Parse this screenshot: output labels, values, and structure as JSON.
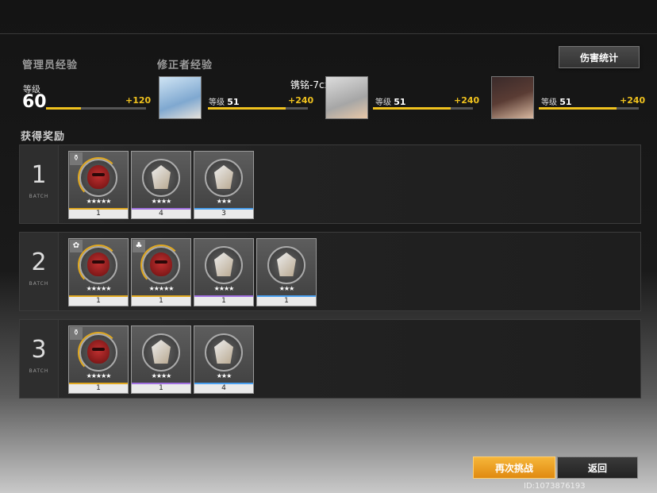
{
  "header": {
    "admin_exp_label": "管理员经验",
    "corrector_exp_label": "修正者经验",
    "damage_stats_button": "伤害统计"
  },
  "admin": {
    "level_label": "等级",
    "level": "60",
    "exp_gain": "+120",
    "exp_progress": 0.35
  },
  "characters": [
    {
      "level_label": "等级",
      "level": "51",
      "exp_gain": "+240",
      "exp_progress": 0.78,
      "portrait": "portrait-blue-hair"
    },
    {
      "level_label": "等级",
      "level": "51",
      "exp_gain": "+240",
      "exp_progress": 0.78,
      "portrait": "portrait-silver-hair",
      "name": "镌铭-7сх"
    },
    {
      "level_label": "等级",
      "level": "51",
      "exp_gain": "+240",
      "exp_progress": 0.78,
      "portrait": "portrait-dark-hair"
    }
  ],
  "rewards_label": "获得奖励",
  "batch_word": "BATCH",
  "batches": [
    {
      "number": "1",
      "items": [
        {
          "kind": "mask",
          "stars": "★★★★★",
          "count": "1",
          "rarity_color": "#e0a820",
          "tag": "⚱"
        },
        {
          "kind": "wing",
          "stars": "★★★★",
          "count": "4",
          "rarity_color": "#a070e0"
        },
        {
          "kind": "wing",
          "stars": "★★★",
          "count": "3",
          "rarity_color": "#4aa0f0"
        }
      ]
    },
    {
      "number": "2",
      "items": [
        {
          "kind": "mask",
          "stars": "★★★★★",
          "count": "1",
          "rarity_color": "#e0a820",
          "tag": "✿"
        },
        {
          "kind": "mask",
          "stars": "★★★★★",
          "count": "1",
          "rarity_color": "#e0a820",
          "tag": "♣"
        },
        {
          "kind": "wing",
          "stars": "★★★★",
          "count": "1",
          "rarity_color": "#a070e0"
        },
        {
          "kind": "wing",
          "stars": "★★★",
          "count": "1",
          "rarity_color": "#4aa0f0"
        }
      ]
    },
    {
      "number": "3",
      "items": [
        {
          "kind": "mask",
          "stars": "★★★★★",
          "count": "1",
          "rarity_color": "#e0a820",
          "tag": "⚱"
        },
        {
          "kind": "wing",
          "stars": "★★★★",
          "count": "1",
          "rarity_color": "#a070e0"
        },
        {
          "kind": "wing",
          "stars": "★★★",
          "count": "4",
          "rarity_color": "#4aa0f0"
        }
      ]
    }
  ],
  "footer": {
    "retry_button": "再次挑战",
    "back_button": "返回",
    "uid": "ID:1073876193"
  },
  "colors": {
    "accent": "#f0c21e",
    "retry": "#f0a020"
  }
}
